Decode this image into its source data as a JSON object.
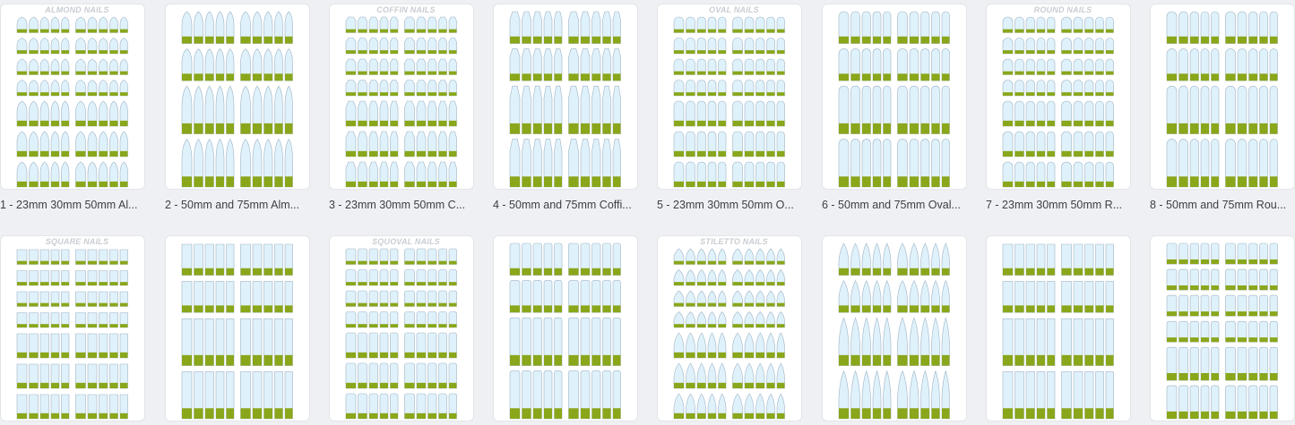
{
  "colors": {
    "page_bg": "#eef0f3",
    "card_bg": "#ffffff",
    "nail_fill": "#dff2fb",
    "nail_stroke": "#9fb3c4",
    "nail_base": "#8aa61b",
    "caption_text": "#3b3f45",
    "sheet_title": "#c9cdd2"
  },
  "tiles": [
    {
      "caption": "1 - 23mm 30mm 50mm Al...",
      "sheet_title": "ALMOND NAILS",
      "shape": "almond",
      "rows": [
        1,
        1,
        1,
        1,
        1.6,
        1.6,
        1.6
      ]
    },
    {
      "caption": "2 - 50mm and 75mm Alm...",
      "sheet_title": "",
      "shape": "almond",
      "rows": [
        1.6,
        1.6,
        2.4,
        2.4
      ]
    },
    {
      "caption": "3 - 23mm 30mm 50mm C...",
      "sheet_title": "COFFIN NAILS",
      "shape": "coffin",
      "rows": [
        1,
        1,
        1,
        1,
        1.6,
        1.6,
        1.6
      ]
    },
    {
      "caption": "4 - 50mm and 75mm Coffi...",
      "sheet_title": "",
      "shape": "coffin",
      "rows": [
        1.6,
        1.6,
        2.4,
        2.4
      ]
    },
    {
      "caption": "5 - 23mm 30mm 50mm O...",
      "sheet_title": "OVAL NAILS",
      "shape": "oval",
      "rows": [
        1,
        1,
        1,
        1,
        1.6,
        1.6,
        1.6
      ]
    },
    {
      "caption": "6 - 50mm and 75mm Oval...",
      "sheet_title": "",
      "shape": "oval",
      "rows": [
        1.6,
        1.6,
        2.4,
        2.4
      ]
    },
    {
      "caption": "7 - 23mm 30mm 50mm R...",
      "sheet_title": "ROUND NAILS",
      "shape": "round",
      "rows": [
        1,
        1,
        1,
        1,
        1.6,
        1.6,
        1.6
      ]
    },
    {
      "caption": "8 - 50mm and 75mm Rou...",
      "sheet_title": "",
      "shape": "round",
      "rows": [
        1.6,
        1.6,
        2.4,
        2.4
      ]
    },
    {
      "caption": "",
      "sheet_title": "SQUARE NAILS",
      "shape": "square",
      "rows": [
        1,
        1,
        1,
        1,
        1.6,
        1.6,
        1.6
      ]
    },
    {
      "caption": "",
      "sheet_title": "",
      "shape": "square",
      "rows": [
        1.6,
        1.6,
        2.4,
        2.4
      ]
    },
    {
      "caption": "",
      "sheet_title": "SQUOVAL NAILS",
      "shape": "squoval",
      "rows": [
        1,
        1,
        1,
        1,
        1.6,
        1.6,
        1.6
      ]
    },
    {
      "caption": "",
      "sheet_title": "",
      "shape": "squoval",
      "rows": [
        1.6,
        1.6,
        2.4,
        2.4
      ]
    },
    {
      "caption": "",
      "sheet_title": "STILETTO NAILS",
      "shape": "stiletto",
      "rows": [
        1,
        1,
        1,
        1,
        1.6,
        1.6,
        1.6
      ]
    },
    {
      "caption": "",
      "sheet_title": "",
      "shape": "stiletto",
      "rows": [
        1.6,
        1.6,
        2.4,
        2.4
      ]
    },
    {
      "caption": "",
      "sheet_title": "",
      "shape": "square",
      "rows": [
        1.6,
        1.6,
        2.4,
        2.4
      ]
    },
    {
      "caption": "",
      "sheet_title": "",
      "shape": "squoval",
      "rows": [
        1,
        1,
        1,
        1,
        1.6,
        1.6
      ]
    }
  ]
}
